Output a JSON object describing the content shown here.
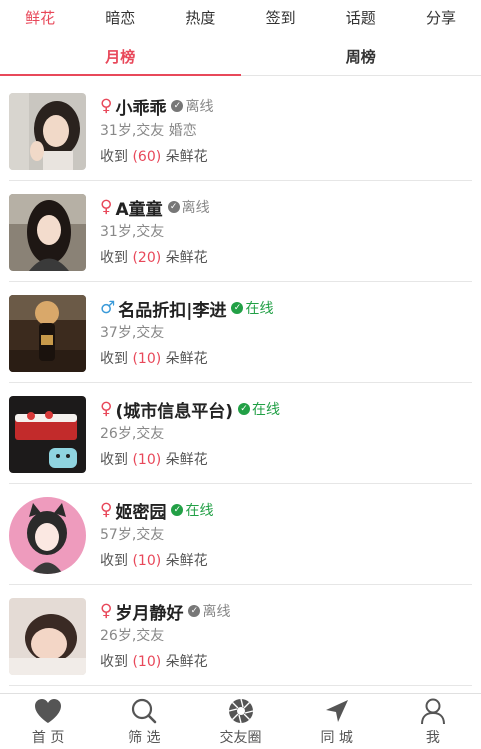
{
  "top_tabs": [
    "鲜花",
    "暗恋",
    "热度",
    "签到",
    "话题",
    "分享"
  ],
  "sub_tabs": [
    "月榜",
    "周榜"
  ],
  "received_prefix": "收到",
  "received_suffix": "朵鲜花",
  "users": [
    {
      "gender_symbol": "♀",
      "name": "小乖乖",
      "status": "离线",
      "info": "31岁,交友 婚恋",
      "count": "(60)"
    },
    {
      "gender_symbol": "♀",
      "name": "A童童",
      "status": "离线",
      "info": "31岁,交友",
      "count": "(20)"
    },
    {
      "gender_symbol": "♂",
      "name": "名品折扣|李进",
      "status": "在线",
      "info": "37岁,交友",
      "count": "(10)"
    },
    {
      "gender_symbol": "♀",
      "name": "(城市信息平台)",
      "status": "在线",
      "info": "26岁,交友",
      "count": "(10)"
    },
    {
      "gender_symbol": "♀",
      "name": "姬密园",
      "status": "在线",
      "info": "57岁,交友",
      "count": "(10)"
    },
    {
      "gender_symbol": "♀",
      "name": "岁月静好",
      "status": "离线",
      "info": "26岁,交友",
      "count": "(10)"
    }
  ],
  "bottom_nav": [
    {
      "label": "首 页",
      "icon": "heart-icon"
    },
    {
      "label": "筛 选",
      "icon": "search-icon"
    },
    {
      "label": "交友圈",
      "icon": "aperture-icon"
    },
    {
      "label": "同 城",
      "icon": "location-arrow-icon"
    },
    {
      "label": "我",
      "icon": "user-icon"
    }
  ],
  "colors": {
    "accent": "#e8485a",
    "online": "#22a046",
    "male": "#3a9ad9"
  }
}
